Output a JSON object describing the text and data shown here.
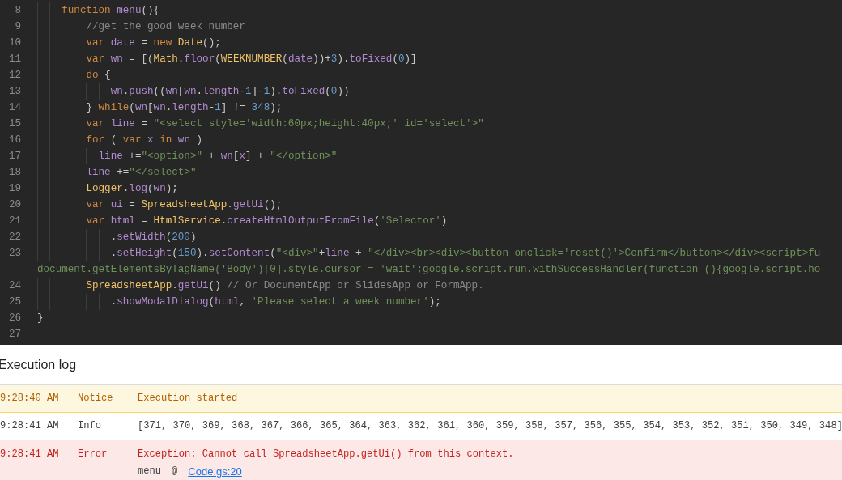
{
  "editor": {
    "lines": [
      {
        "number": "8",
        "tokens": [
          {
            "kind": "keyword",
            "text": "    function"
          },
          {
            "kind": "name",
            "text": " menu"
          },
          {
            "kind": "plain",
            "text": "(){"
          }
        ]
      },
      {
        "number": "9",
        "tokens": [
          {
            "kind": "comment",
            "text": "        //get the good week number"
          }
        ]
      },
      {
        "number": "10",
        "tokens": [
          {
            "kind": "keyword",
            "text": "        var"
          },
          {
            "kind": "name",
            "text": " date"
          },
          {
            "kind": "plain",
            "text": " = "
          },
          {
            "kind": "keyword",
            "text": "new"
          },
          {
            "kind": "class",
            "text": " Date"
          },
          {
            "kind": "plain",
            "text": "();"
          }
        ]
      },
      {
        "number": "11",
        "tokens": [
          {
            "kind": "keyword",
            "text": "        var"
          },
          {
            "kind": "name",
            "text": " wn"
          },
          {
            "kind": "plain",
            "text": " = [("
          },
          {
            "kind": "class",
            "text": "Math"
          },
          {
            "kind": "plain",
            "text": "."
          },
          {
            "kind": "name",
            "text": "floor"
          },
          {
            "kind": "plain",
            "text": "("
          },
          {
            "kind": "class",
            "text": "WEEKNUMBER"
          },
          {
            "kind": "plain",
            "text": "("
          },
          {
            "kind": "name",
            "text": "date"
          },
          {
            "kind": "plain",
            "text": "))+"
          },
          {
            "kind": "number",
            "text": "3"
          },
          {
            "kind": "plain",
            "text": ")."
          },
          {
            "kind": "name",
            "text": "toFixed"
          },
          {
            "kind": "plain",
            "text": "("
          },
          {
            "kind": "number",
            "text": "0"
          },
          {
            "kind": "plain",
            "text": ")]"
          }
        ]
      },
      {
        "number": "12",
        "tokens": [
          {
            "kind": "keyword",
            "text": "        do"
          },
          {
            "kind": "plain",
            "text": " {"
          }
        ]
      },
      {
        "number": "13",
        "tokens": [
          {
            "kind": "name",
            "text": "            wn"
          },
          {
            "kind": "plain",
            "text": "."
          },
          {
            "kind": "name",
            "text": "push"
          },
          {
            "kind": "plain",
            "text": "(("
          },
          {
            "kind": "name",
            "text": "wn"
          },
          {
            "kind": "plain",
            "text": "["
          },
          {
            "kind": "name",
            "text": "wn"
          },
          {
            "kind": "plain",
            "text": "."
          },
          {
            "kind": "name",
            "text": "length"
          },
          {
            "kind": "plain",
            "text": "-"
          },
          {
            "kind": "number",
            "text": "1"
          },
          {
            "kind": "plain",
            "text": "]-"
          },
          {
            "kind": "number",
            "text": "1"
          },
          {
            "kind": "plain",
            "text": ")."
          },
          {
            "kind": "name",
            "text": "toFixed"
          },
          {
            "kind": "plain",
            "text": "("
          },
          {
            "kind": "number",
            "text": "0"
          },
          {
            "kind": "plain",
            "text": "))"
          }
        ]
      },
      {
        "number": "14",
        "tokens": [
          {
            "kind": "plain",
            "text": "        } "
          },
          {
            "kind": "keyword",
            "text": "while"
          },
          {
            "kind": "plain",
            "text": "("
          },
          {
            "kind": "name",
            "text": "wn"
          },
          {
            "kind": "plain",
            "text": "["
          },
          {
            "kind": "name",
            "text": "wn"
          },
          {
            "kind": "plain",
            "text": "."
          },
          {
            "kind": "name",
            "text": "length"
          },
          {
            "kind": "plain",
            "text": "-"
          },
          {
            "kind": "number",
            "text": "1"
          },
          {
            "kind": "plain",
            "text": "] != "
          },
          {
            "kind": "number",
            "text": "348"
          },
          {
            "kind": "plain",
            "text": ");"
          }
        ]
      },
      {
        "number": "15",
        "tokens": [
          {
            "kind": "keyword",
            "text": "        var"
          },
          {
            "kind": "name",
            "text": " line"
          },
          {
            "kind": "plain",
            "text": " = "
          },
          {
            "kind": "string",
            "text": "\"<select style='width:60px;height:40px;' id='select'>\""
          }
        ]
      },
      {
        "number": "16",
        "tokens": [
          {
            "kind": "keyword",
            "text": "        for"
          },
          {
            "kind": "plain",
            "text": " ( "
          },
          {
            "kind": "keyword",
            "text": "var"
          },
          {
            "kind": "name",
            "text": " x"
          },
          {
            "kind": "keyword",
            "text": " in"
          },
          {
            "kind": "name",
            "text": " wn"
          },
          {
            "kind": "plain",
            "text": " )"
          }
        ]
      },
      {
        "number": "17",
        "tokens": [
          {
            "kind": "name",
            "text": "          line"
          },
          {
            "kind": "plain",
            "text": " +="
          },
          {
            "kind": "string",
            "text": "\"<option>\""
          },
          {
            "kind": "plain",
            "text": " + "
          },
          {
            "kind": "name",
            "text": "wn"
          },
          {
            "kind": "plain",
            "text": "["
          },
          {
            "kind": "name",
            "text": "x"
          },
          {
            "kind": "plain",
            "text": "] + "
          },
          {
            "kind": "string",
            "text": "\"</option>\""
          }
        ]
      },
      {
        "number": "18",
        "tokens": [
          {
            "kind": "name",
            "text": "        line"
          },
          {
            "kind": "plain",
            "text": " +="
          },
          {
            "kind": "string",
            "text": "\"</select>\""
          }
        ]
      },
      {
        "number": "19",
        "tokens": [
          {
            "kind": "class",
            "text": "        Logger"
          },
          {
            "kind": "plain",
            "text": "."
          },
          {
            "kind": "name",
            "text": "log"
          },
          {
            "kind": "plain",
            "text": "("
          },
          {
            "kind": "name",
            "text": "wn"
          },
          {
            "kind": "plain",
            "text": ");"
          }
        ]
      },
      {
        "number": "20",
        "tokens": [
          {
            "kind": "keyword",
            "text": "        var"
          },
          {
            "kind": "name",
            "text": " ui"
          },
          {
            "kind": "plain",
            "text": " = "
          },
          {
            "kind": "class",
            "text": "SpreadsheetApp"
          },
          {
            "kind": "plain",
            "text": "."
          },
          {
            "kind": "name",
            "text": "getUi"
          },
          {
            "kind": "plain",
            "text": "();"
          }
        ]
      },
      {
        "number": "21",
        "tokens": [
          {
            "kind": "keyword",
            "text": "        var"
          },
          {
            "kind": "name",
            "text": " html"
          },
          {
            "kind": "plain",
            "text": " = "
          },
          {
            "kind": "class",
            "text": "HtmlService"
          },
          {
            "kind": "plain",
            "text": "."
          },
          {
            "kind": "name",
            "text": "createHtmlOutputFromFile"
          },
          {
            "kind": "plain",
            "text": "("
          },
          {
            "kind": "string",
            "text": "'Selector'"
          },
          {
            "kind": "plain",
            "text": ")"
          }
        ]
      },
      {
        "number": "22",
        "tokens": [
          {
            "kind": "plain",
            "text": "            ."
          },
          {
            "kind": "name",
            "text": "setWidth"
          },
          {
            "kind": "plain",
            "text": "("
          },
          {
            "kind": "number",
            "text": "200"
          },
          {
            "kind": "plain",
            "text": ")"
          }
        ]
      },
      {
        "number": "23",
        "tokens": [
          {
            "kind": "plain",
            "text": "            ."
          },
          {
            "kind": "name",
            "text": "setHeight"
          },
          {
            "kind": "plain",
            "text": "("
          },
          {
            "kind": "number",
            "text": "150"
          },
          {
            "kind": "plain",
            "text": ")."
          },
          {
            "kind": "name",
            "text": "setContent"
          },
          {
            "kind": "plain",
            "text": "("
          },
          {
            "kind": "string",
            "text": "\"<div>\""
          },
          {
            "kind": "plain",
            "text": "+"
          },
          {
            "kind": "name",
            "text": "line"
          },
          {
            "kind": "plain",
            "text": " + "
          },
          {
            "kind": "string",
            "text": "\"</div><br><div><button onclick='reset()'>Confirm</button></div><script>fu"
          }
        ]
      },
      {
        "tokens": [
          {
            "kind": "string",
            "text": "document.getElementsByTagName('Body')[0].style.cursor = 'wait';google.script.run.withSuccessHandler(function (){google.script.ho"
          }
        ]
      },
      {
        "number": "24",
        "tokens": [
          {
            "kind": "class",
            "text": "        SpreadsheetApp"
          },
          {
            "kind": "plain",
            "text": "."
          },
          {
            "kind": "name",
            "text": "getUi"
          },
          {
            "kind": "plain",
            "text": "() "
          },
          {
            "kind": "comment",
            "text": "// Or DocumentApp or SlidesApp or FormApp."
          }
        ]
      },
      {
        "number": "25",
        "tokens": [
          {
            "kind": "plain",
            "text": "            ."
          },
          {
            "kind": "name",
            "text": "showModalDialog"
          },
          {
            "kind": "plain",
            "text": "("
          },
          {
            "kind": "name",
            "text": "html"
          },
          {
            "kind": "plain",
            "text": ", "
          },
          {
            "kind": "string",
            "text": "'Please select a week number'"
          },
          {
            "kind": "plain",
            "text": ");"
          }
        ]
      },
      {
        "number": "26",
        "tokens": [
          {
            "kind": "plain",
            "text": "}"
          }
        ]
      },
      {
        "number": "27"
      }
    ]
  },
  "execution_log": {
    "title": "Execution log",
    "rows": [
      {
        "kind": "notice",
        "time": "9:28:40 AM",
        "level": "Notice",
        "message": "Execution started"
      },
      {
        "kind": "info",
        "time": "9:28:41 AM",
        "level": "Info",
        "message": "[371, 370, 369, 368, 367, 366, 365, 364, 363, 362, 361, 360, 359, 358, 357, 356, 355, 354, 353, 352, 351, 350, 349, 348]"
      },
      {
        "kind": "error",
        "time": "9:28:41 AM",
        "level": "Error",
        "message": "Exception: Cannot call SpreadsheetApp.getUi() from this context.",
        "trace": {
          "function": "menu",
          "separator": "@",
          "link": "Code.gs:20"
        }
      }
    ]
  }
}
